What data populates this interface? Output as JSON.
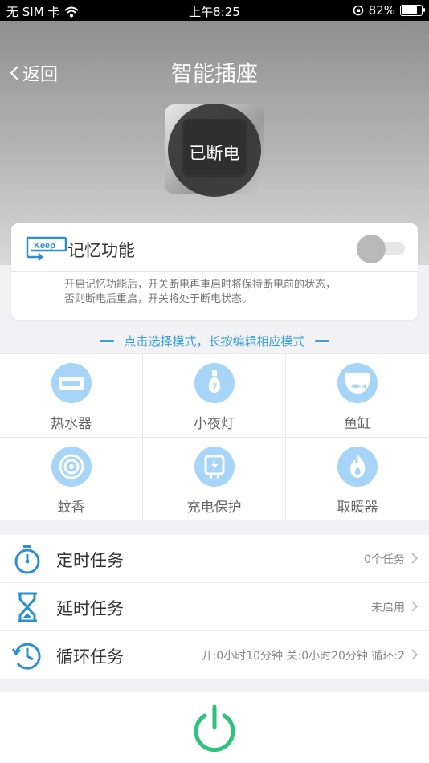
{
  "status_bar": {
    "carrier": "无 SIM 卡",
    "time": "上午8:25",
    "battery": "82%",
    "battery_level": 0.82
  },
  "header": {
    "back_label": "返回",
    "title": "智能插座",
    "socket_status": "已断电"
  },
  "memory": {
    "icon_text": "Keep",
    "title": "记忆功能",
    "toggle_on": false,
    "desc_line1": "开启记忆功能后，开关断电再重启时将保持断电前的状态，",
    "desc_line2": "否则断电后重启，开关将处于断电状态。"
  },
  "mode_hint": "点击选择模式，长按编辑相应模式",
  "modes": [
    {
      "label": "热水器",
      "icon": "water-heater-icon"
    },
    {
      "label": "小夜灯",
      "icon": "night-light-icon"
    },
    {
      "label": "鱼缸",
      "icon": "fish-tank-icon"
    },
    {
      "label": "蚊香",
      "icon": "mosquito-coil-icon"
    },
    {
      "label": "充电保护",
      "icon": "charging-protection-icon"
    },
    {
      "label": "取暖器",
      "icon": "heater-icon"
    }
  ],
  "tasks": [
    {
      "label": "定时任务",
      "value": "0个任务",
      "icon": "timer-icon"
    },
    {
      "label": "延时任务",
      "value": "未启用",
      "icon": "hourglass-icon"
    },
    {
      "label": "循环任务",
      "value": "开:0小时10分钟 关:0小时20分钟 循环:2",
      "icon": "cycle-clock-icon"
    }
  ],
  "colors": {
    "accent_blue": "#3aa0e0",
    "icon_bg": "#a7d5f7",
    "power_green": "#2ec27e"
  }
}
